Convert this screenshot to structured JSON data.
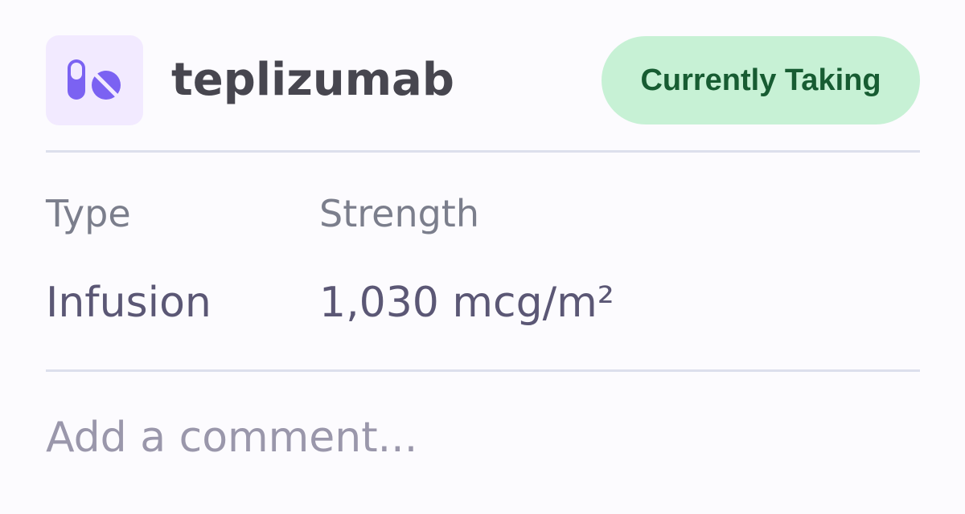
{
  "medication": {
    "name": "teplizumab",
    "icon": "pill-icon",
    "icon_color": "#7b62f2",
    "icon_bg": "#f2eaff",
    "status": "Currently Taking",
    "status_bg": "#c7f1d5",
    "status_color": "#175c32"
  },
  "details": {
    "type_label": "Type",
    "type_value": "Infusion",
    "strength_label": "Strength",
    "strength_value": "1,030 mcg/m²"
  },
  "comment": {
    "value": "",
    "placeholder": "Add a comment..."
  }
}
